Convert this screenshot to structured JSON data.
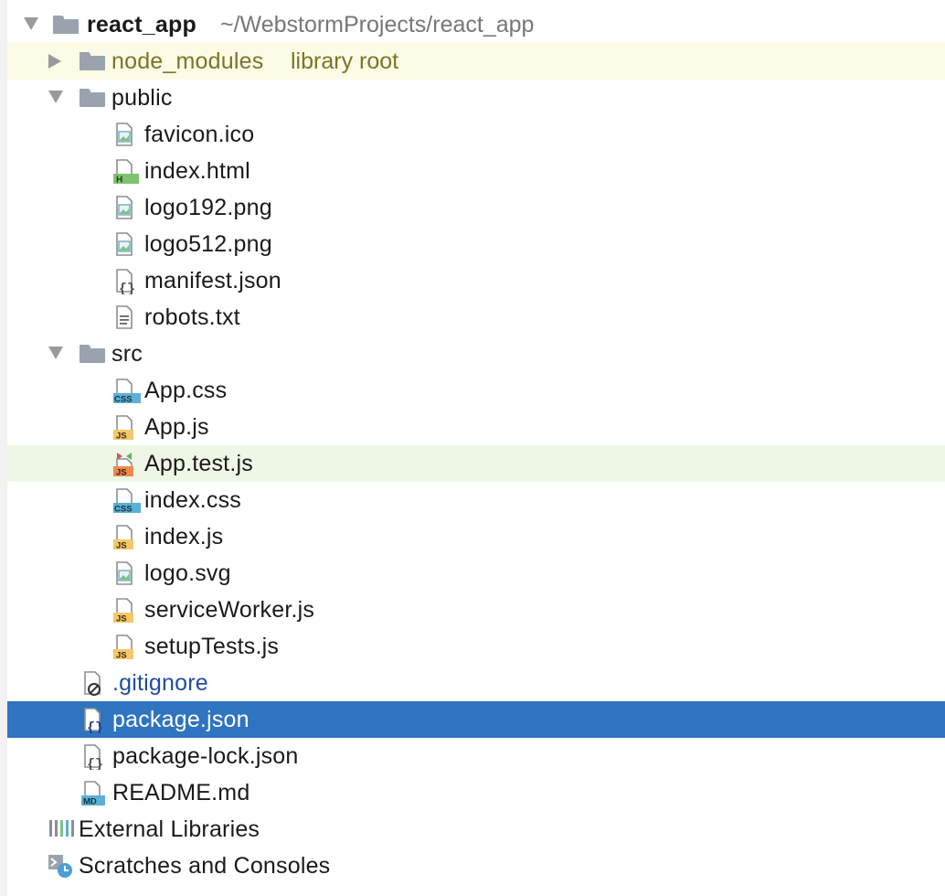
{
  "tree": {
    "root": {
      "name": "react_app",
      "path": "~/WebstormProjects/react_app"
    },
    "node_modules": {
      "name": "node_modules",
      "hint": "library root"
    },
    "public": {
      "name": "public",
      "files": [
        "favicon.ico",
        "index.html",
        "logo192.png",
        "logo512.png",
        "manifest.json",
        "robots.txt"
      ]
    },
    "src": {
      "name": "src",
      "files": [
        "App.css",
        "App.js",
        "App.test.js",
        "index.css",
        "index.js",
        "logo.svg",
        "serviceWorker.js",
        "setupTests.js"
      ]
    },
    "root_files": [
      ".gitignore",
      "package.json",
      "package-lock.json",
      "README.md"
    ],
    "external_libraries": "External Libraries",
    "scratches": "Scratches and Consoles"
  },
  "icon_labels": {
    "css": "CSS",
    "js": "JS",
    "html": "H",
    "md": "MD"
  },
  "colors": {
    "selection": "#2f74c0",
    "library_root_highlight": "#fcfbe6",
    "test_file_highlight": "#eef7e6",
    "ignored_file_text": "#1f4da0",
    "library_text": "#7a7526"
  }
}
